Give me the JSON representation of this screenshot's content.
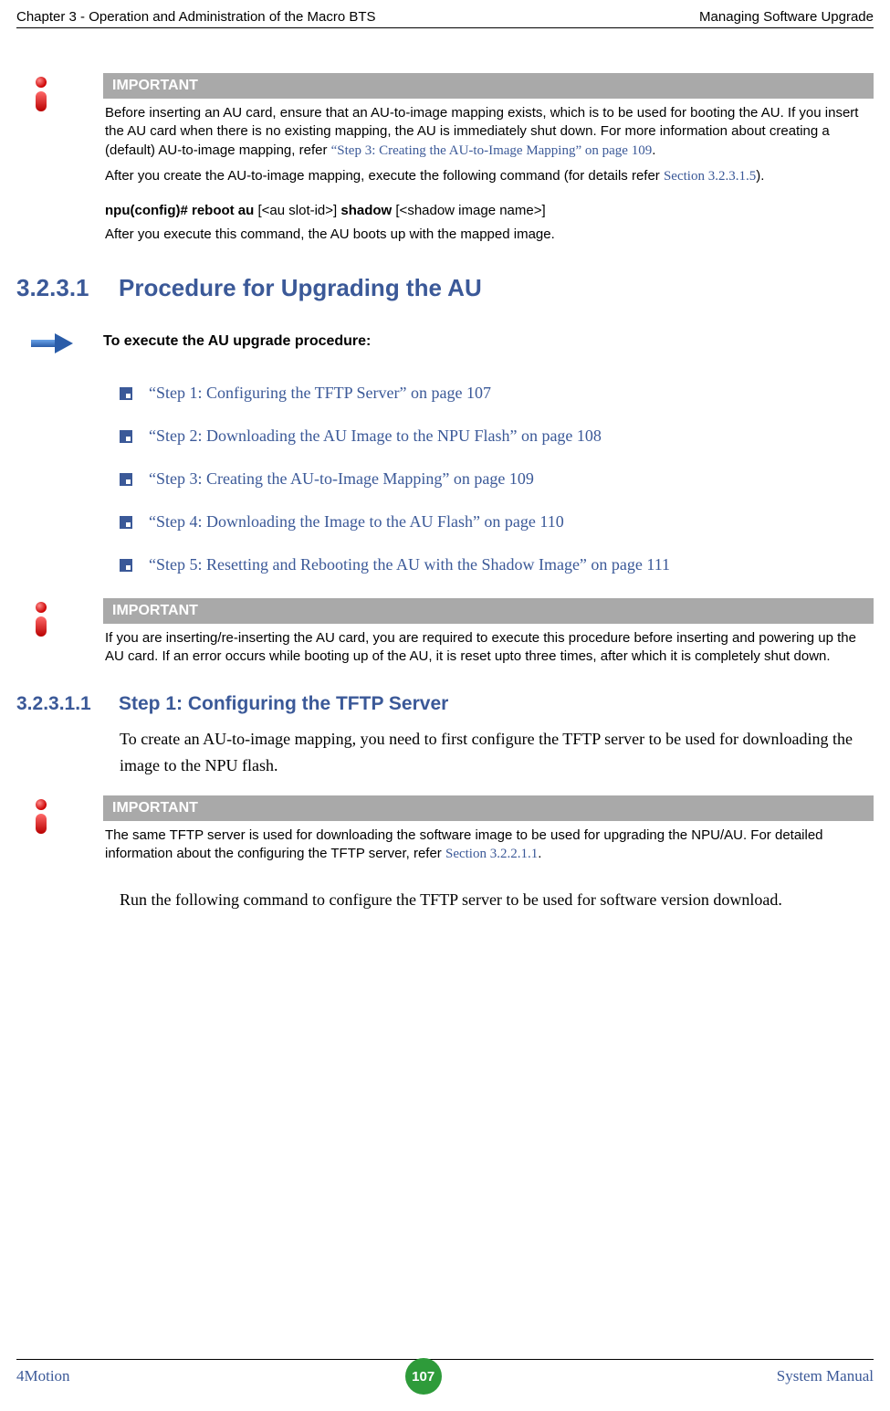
{
  "header": {
    "left": "Chapter 3 - Operation and Administration of the Macro BTS",
    "right": "Managing Software Upgrade"
  },
  "important1": {
    "label": "IMPORTANT",
    "p1a": "Before inserting an AU card, ensure that an AU-to-image mapping exists, which is to be used for booting the AU. If you insert the AU card when there is no existing mapping, the AU is immediately shut down. For more information about creating a (default) AU-to-image mapping, refer ",
    "p1link": "“Step 3: Creating the AU-to-Image Mapping” on page 109",
    "p1b": ".",
    "p2a": "After you create the AU-to-image mapping, execute the following command (for details refer ",
    "p2link": "Section 3.2.3.1.5",
    "p2b": ").",
    "cmd_b1": "npu(config)# reboot au ",
    "cmd_n1": "[<au slot-id>] ",
    "cmd_b2": "shadow ",
    "cmd_n2": "[<shadow image name>]",
    "p3": "After you execute this command, the AU boots up with the mapped image."
  },
  "section": {
    "num": "3.2.3.1",
    "title": "Procedure for Upgrading the AU"
  },
  "procedure": {
    "title": "To execute the AU upgrade procedure:"
  },
  "steps": [
    "“Step 1: Configuring the TFTP Server” on page 107",
    "“Step 2: Downloading the AU Image to the NPU Flash” on page 108",
    "“Step 3: Creating the AU-to-Image Mapping” on page 109",
    "“Step 4: Downloading the Image to the AU Flash” on page 110",
    "“Step 5: Resetting and Rebooting the AU with the Shadow Image” on page 111"
  ],
  "important2": {
    "label": "IMPORTANT",
    "text": "If you are inserting/re-inserting the AU card, you are required to execute this procedure before inserting and powering up the AU card. If an error occurs while booting up of the AU, it is reset upto three times, after which it is completely shut down."
  },
  "subsection": {
    "num": "3.2.3.1.1",
    "title": "Step 1: Configuring the TFTP Server"
  },
  "body1": "To create an AU-to-image mapping, you need to first configure the TFTP server to be used for downloading the image to the NPU flash.",
  "important3": {
    "label": "IMPORTANT",
    "texta": "The same TFTP server is used for downloading the software image to be used for upgrading the NPU/AU. For detailed information about the configuring the TFTP server, refer ",
    "link": "Section 3.2.2.1.1",
    "textb": "."
  },
  "body2": "Run the following command to configure the TFTP server to be used for software version download.",
  "footer": {
    "left": "4Motion",
    "page": "107",
    "right": "System Manual"
  }
}
